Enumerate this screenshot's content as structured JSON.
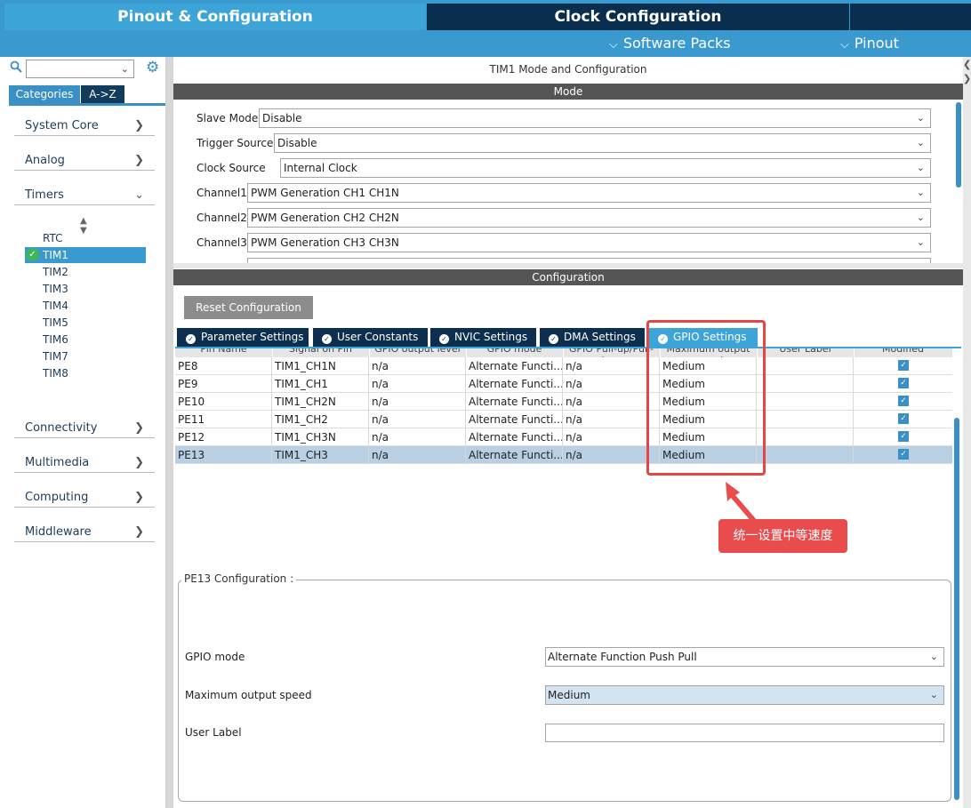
{
  "header": {
    "tabs": [
      {
        "label": "Pinout & Configuration",
        "active": true
      },
      {
        "label": "Clock Configuration",
        "active": false
      }
    ],
    "subnav": [
      {
        "label": "Software Packs"
      },
      {
        "label": "Pinout"
      }
    ]
  },
  "left": {
    "search_value": "",
    "view_tabs": [
      "Categories",
      "A->Z"
    ],
    "categories": [
      {
        "label": "System Core",
        "expanded": false
      },
      {
        "label": "Analog",
        "expanded": false
      },
      {
        "label": "Timers",
        "expanded": true
      },
      {
        "label": "Connectivity",
        "expanded": false
      },
      {
        "label": "Multimedia",
        "expanded": false
      },
      {
        "label": "Computing",
        "expanded": false
      },
      {
        "label": "Middleware",
        "expanded": false
      }
    ],
    "timers": [
      "RTC",
      "TIM1",
      "TIM2",
      "TIM3",
      "TIM4",
      "TIM5",
      "TIM6",
      "TIM7",
      "TIM8"
    ],
    "selected_timer": "TIM1"
  },
  "panel_title": "TIM1 Mode and Configuration",
  "mode": {
    "header": "Mode",
    "fields": [
      {
        "label": "Slave Mode",
        "value": "Disable"
      },
      {
        "label": "Trigger Source",
        "value": "Disable"
      },
      {
        "label": "Clock Source",
        "value": "Internal Clock"
      },
      {
        "label": "Channel1",
        "value": "PWM Generation CH1 CH1N"
      },
      {
        "label": "Channel2",
        "value": "PWM Generation CH2 CH2N"
      },
      {
        "label": "Channel3",
        "value": "PWM Generation CH3 CH3N"
      }
    ]
  },
  "config": {
    "header": "Configuration",
    "reset_label": "Reset Configuration",
    "tabs": [
      {
        "label": "Parameter Settings",
        "active": false
      },
      {
        "label": "User Constants",
        "active": false
      },
      {
        "label": "NVIC Settings",
        "active": false
      },
      {
        "label": "DMA Settings",
        "active": false
      },
      {
        "label": "GPIO Settings",
        "active": true
      }
    ],
    "columns": [
      "Pin Name",
      "Signal on Pin",
      "GPIO output level",
      "GPIO mode",
      "GPIO Pull-up/Pull-down",
      "Maximum output speed",
      "User Label",
      "Modified"
    ],
    "rows": [
      [
        "PE8",
        "TIM1_CH1N",
        "n/a",
        "Alternate Functi...",
        "n/a",
        "Medium",
        "",
        true
      ],
      [
        "PE9",
        "TIM1_CH1",
        "n/a",
        "Alternate Functi...",
        "n/a",
        "Medium",
        "",
        true
      ],
      [
        "PE10",
        "TIM1_CH2N",
        "n/a",
        "Alternate Functi...",
        "n/a",
        "Medium",
        "",
        true
      ],
      [
        "PE11",
        "TIM1_CH2",
        "n/a",
        "Alternate Functi...",
        "n/a",
        "Medium",
        "",
        true
      ],
      [
        "PE12",
        "TIM1_CH3N",
        "n/a",
        "Alternate Functi...",
        "n/a",
        "Medium",
        "",
        true
      ],
      [
        "PE13",
        "TIM1_CH3",
        "n/a",
        "Alternate Functi...",
        "n/a",
        "Medium",
        "",
        true
      ]
    ],
    "selected_row_index": 5
  },
  "annotation": {
    "text": "统一设置中等速度",
    "color": "#e94c4c"
  },
  "pin_config": {
    "title": "PE13 Configuration :",
    "fields": [
      {
        "label": "GPIO mode",
        "value": "Alternate Function Push Pull"
      },
      {
        "label": "Maximum output speed",
        "value": "Medium"
      },
      {
        "label": "User Label",
        "value": ""
      }
    ]
  },
  "colors": {
    "accent": "#3a99cf",
    "dark_tab": "#0a2f4e",
    "section_bar": "#555555",
    "check_green": "#41b35b"
  }
}
